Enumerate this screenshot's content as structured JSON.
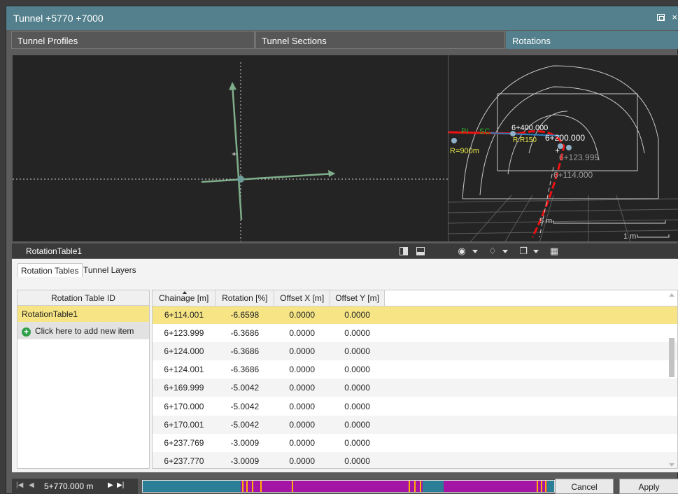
{
  "window": {
    "title": "Tunnel +5770 +7000",
    "restore_icon": "restore-icon",
    "close_glyph": "×"
  },
  "panel_tabs": [
    {
      "label": "Tunnel Profiles"
    },
    {
      "label": "Tunnel Sections"
    },
    {
      "label": "Rotations"
    }
  ],
  "left_view": {
    "table_name": "RotationTable1"
  },
  "right_view": {
    "labels": {
      "pi": "PI",
      "sc": "SC",
      "ch1": "6+400.000",
      "ch2": "6+200.000",
      "ch3": "6+123.999",
      "ch4": "6+114.000",
      "r150": "R:R150",
      "r900": "R=900m",
      "scale5": "5 m",
      "scale1": "1 m"
    }
  },
  "lower": {
    "tabs": [
      {
        "label": "Rotation Tables"
      },
      {
        "label": "Tunnel Layers"
      }
    ],
    "id_panel": {
      "header": "Rotation Table ID",
      "items": [
        {
          "label": "RotationTable1"
        }
      ],
      "add_label": "Click here to add new item"
    },
    "grid": {
      "columns": [
        "Chainage [m]",
        "Rotation [%]",
        "Offset X [m]",
        "Offset Y [m]"
      ],
      "rows": [
        [
          "6+114.001",
          "-6.6598",
          "0.0000",
          "0.0000"
        ],
        [
          "6+123.999",
          "-6.3686",
          "0.0000",
          "0.0000"
        ],
        [
          "6+124.000",
          "-6.3686",
          "0.0000",
          "0.0000"
        ],
        [
          "6+124.001",
          "-6.3686",
          "0.0000",
          "0.0000"
        ],
        [
          "6+169.999",
          "-5.0042",
          "0.0000",
          "0.0000"
        ],
        [
          "6+170.000",
          "-5.0042",
          "0.0000",
          "0.0000"
        ],
        [
          "6+170.001",
          "-5.0042",
          "0.0000",
          "0.0000"
        ],
        [
          "6+237.769",
          "-3.0009",
          "0.0000",
          "0.0000"
        ],
        [
          "6+237.770",
          "-3.0009",
          "0.0000",
          "0.0000"
        ]
      ],
      "selected_row": 0
    }
  },
  "bottom": {
    "chainage": "5+770.000 m",
    "cancel_label": "Cancel",
    "apply_label": "Apply"
  },
  "colors": {
    "accent": "#53808c",
    "selection": "#f7e585",
    "timeline_base": "#2a7f96",
    "timeline_segment": "#a515a5",
    "timeline_tick": "#ffb000"
  }
}
